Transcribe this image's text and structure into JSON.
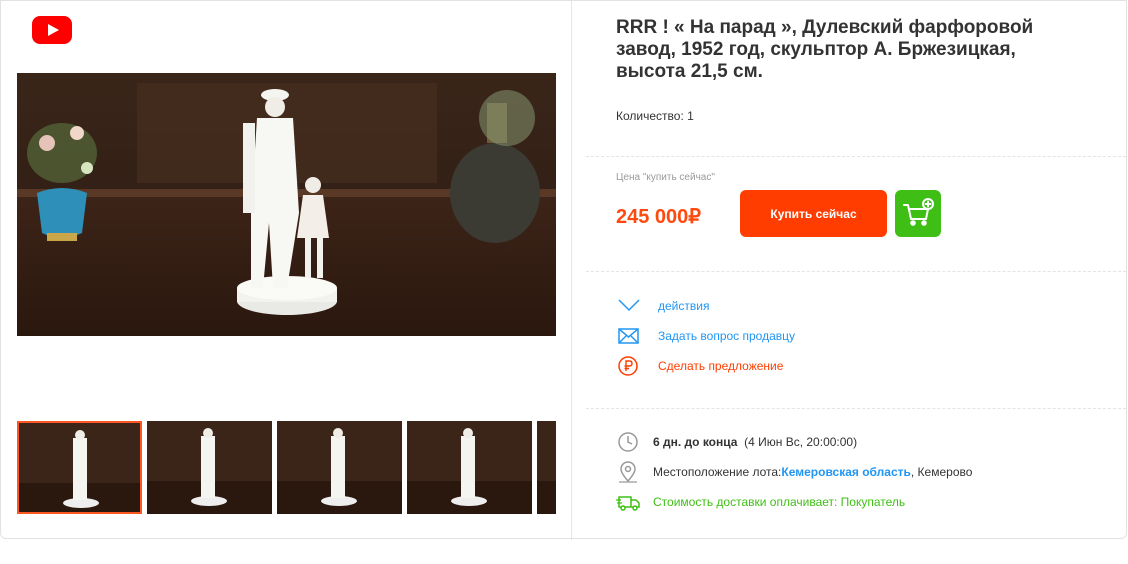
{
  "title": "RRR ! « На парад », Дулевский фарфоровой завод, 1952 год, скульптор А. Бржезицкая, высота 21,5 см.",
  "quantity": "Количество: 1",
  "price_label": "Цена \"купить сейчас\"",
  "price": "245 000₽",
  "buy_button": "Купить сейчас",
  "actions": {
    "more": "действия",
    "ask_seller": "Задать вопрос продавцу",
    "make_offer": "Сделать предложение"
  },
  "info": {
    "time_left": "6 дн. до конца",
    "end_date": "(4 Июн Вс, 20:00:00)",
    "location_label": "Местоположение лота:",
    "region": "Кемеровская область",
    "city": ", Кемерово",
    "shipping": "Стоимость доставки оплачивает: Покупатель"
  },
  "colors": {
    "accent_orange": "#ff3d00",
    "price_orange": "#ff4a0f",
    "cart_green": "#3fbf16",
    "link_blue": "#2196f3",
    "youtube_red": "#ff0000"
  },
  "icons": [
    "youtube-icon",
    "chevron-down-icon",
    "envelope-icon",
    "ruble-circle-icon",
    "cart-add-icon",
    "clock-icon",
    "location-pin-icon",
    "delivery-truck-icon"
  ]
}
